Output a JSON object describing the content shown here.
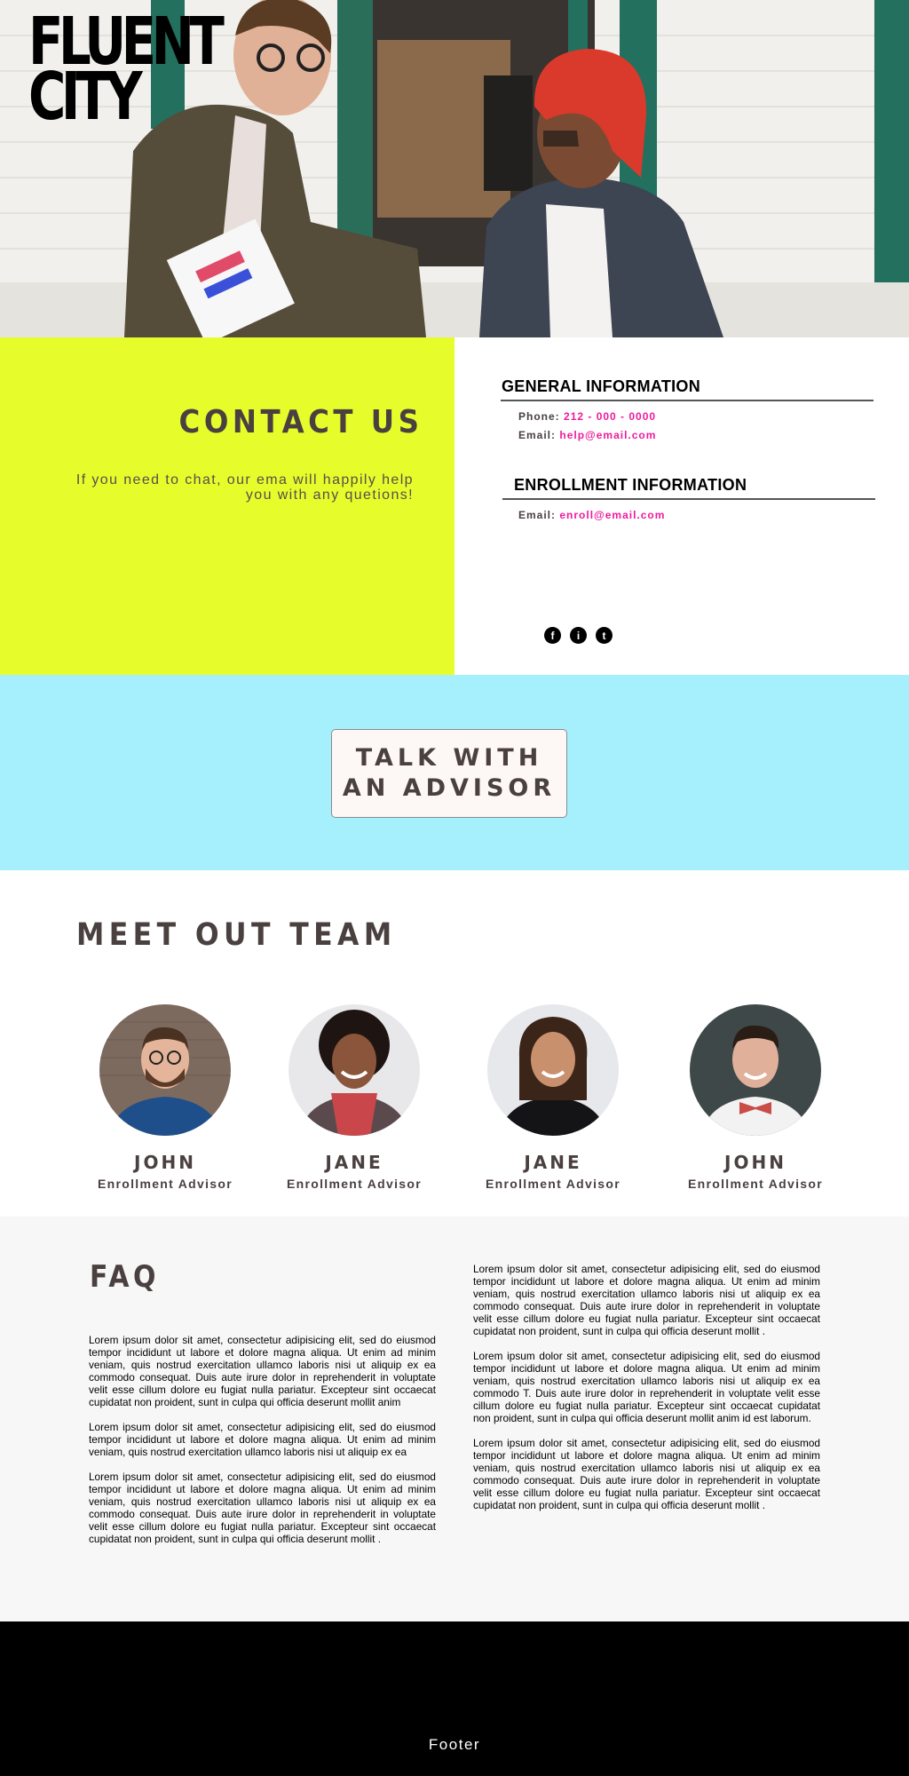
{
  "brand": {
    "line1": "FLUENT",
    "line2": "CITY"
  },
  "contact": {
    "title": "CONTACT US",
    "text": "If you need to chat, our ema will happily help you with any quetions!"
  },
  "general_info": {
    "heading": "GENERAL INFORMATION",
    "phone_label": "Phone:",
    "phone": "212 - 000 - 0000",
    "email_label": "Email:",
    "email": "help@email.com"
  },
  "enrollment_info": {
    "heading": "ENROLLMENT INFORMATION",
    "email_label": "Email:",
    "email": "enroll@email.com"
  },
  "socials": [
    {
      "icon": "facebook-icon",
      "glyph": "f"
    },
    {
      "icon": "instagram-icon",
      "glyph": "i"
    },
    {
      "icon": "twitter-icon",
      "glyph": "t"
    }
  ],
  "advisor": {
    "button_label": "TALK WITH AN ADVISOR"
  },
  "team": {
    "title": "MEET OUT TEAM",
    "members": [
      {
        "name": "JOHN",
        "role": "Enrollment Advisor"
      },
      {
        "name": "JANE",
        "role": "Enrollment Advisor"
      },
      {
        "name": "JANE",
        "role": "Enrollment Advisor"
      },
      {
        "name": "JOHN",
        "role": "Enrollment Advisor"
      }
    ]
  },
  "faq": {
    "title": "FAQ",
    "left": [
      "Lorem ipsum dolor sit amet, consectetur adipisicing elit, sed do eiusmod tempor incididunt ut labore et dolore magna aliqua. Ut enim ad minim veniam, quis nostrud exercitation ullamco laboris nisi ut aliquip ex ea commodo consequat. Duis aute irure dolor in reprehenderit in voluptate velit esse cillum dolore eu fugiat nulla pariatur. Excepteur sint occaecat cupidatat non proident, sunt in culpa qui officia deserunt mollit anim",
      "Lorem ipsum dolor sit amet, consectetur adipisicing elit, sed do eiusmod tempor incididunt ut labore et dolore magna aliqua. Ut enim ad minim veniam, quis nostrud exercitation ullamco laboris nisi ut aliquip ex ea",
      "Lorem ipsum dolor sit amet, consectetur adipisicing elit, sed do eiusmod tempor incididunt ut labore et dolore magna aliqua. Ut enim ad minim veniam, quis nostrud exercitation ullamco laboris nisi ut aliquip ex ea commodo consequat. Duis aute irure dolor in reprehenderit in voluptate velit esse cillum dolore eu fugiat nulla pariatur. Excepteur sint occaecat cupidatat non proident, sunt in culpa qui officia deserunt mollit ."
    ],
    "right": [
      "Lorem ipsum dolor sit amet, consectetur adipisicing elit, sed do eiusmod tempor incididunt ut labore et dolore magna aliqua. Ut enim ad minim veniam, quis nostrud exercitation ullamco laboris nisi ut aliquip ex ea commodo consequat. Duis aute irure dolor in reprehenderit in voluptate velit esse cillum dolore eu fugiat nulla pariatur. Excepteur sint occaecat cupidatat non proident, sunt in culpa qui officia deserunt mollit .",
      "Lorem ipsum dolor sit amet, consectetur adipisicing elit, sed do eiusmod tempor incididunt ut labore et dolore magna aliqua. Ut enim ad minim veniam, quis nostrud exercitation ullamco laboris nisi ut aliquip ex ea commodo T. Duis aute irure dolor in reprehenderit in voluptate velit esse cillum dolore eu fugiat nulla pariatur. Excepteur sint occaecat cupidatat non proident, sunt in culpa qui officia deserunt mollit anim id est laborum.",
      "Lorem ipsum dolor sit amet, consectetur adipisicing elit, sed do eiusmod tempor incididunt ut labore et dolore magna aliqua. Ut enim ad minim veniam, quis nostrud exercitation ullamco laboris nisi ut aliquip ex ea commodo consequat. Duis aute irure dolor in reprehenderit in voluptate velit esse cillum dolore eu fugiat nulla pariatur. Excepteur sint occaecat cupidatat non proident, sunt in culpa qui officia deserunt mollit ."
    ]
  },
  "footer": {
    "text": "Footer"
  },
  "colors": {
    "contact_bg": "#e6fd2b",
    "advisor_bg": "#a6effc",
    "accent_pink": "#ef1a9d",
    "heading_dark": "#4a4040",
    "faq_bg": "#f7f7f7",
    "footer_bg": "#000000"
  }
}
